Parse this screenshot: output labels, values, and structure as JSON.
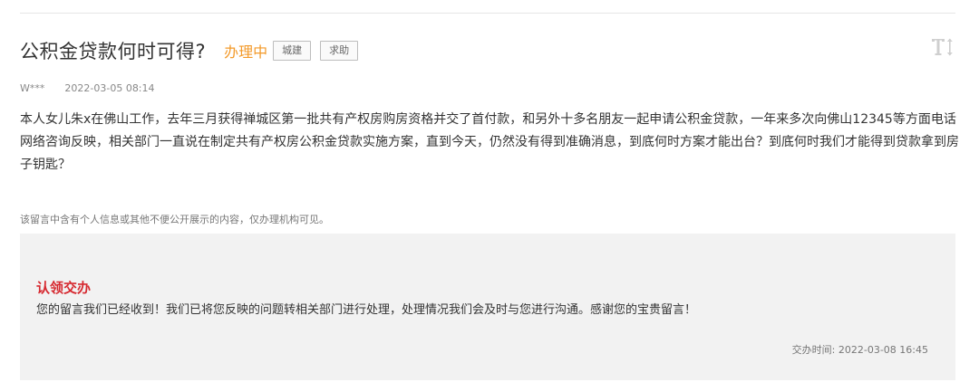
{
  "post": {
    "title": "公积金贷款何时可得?",
    "status": "办理中",
    "tags": [
      "城建",
      "求助"
    ],
    "author": "W***",
    "date": "2022-03-05 08:14",
    "content": "本人女儿朱x在佛山工作，去年三月获得禅城区第一批共有产权房购房资格并交了首付款，和另外十多名朋友一起申请公积金贷款，一年来多次向佛山12345等方面电话网络咨询反映，相关部门一直说在制定共有产权房公积金贷款实施方案，直到今天，仍然没有得到准确消息，到底何时方案才能出台？到底何时我们才能得到贷款拿到房子钥匙？",
    "privacy_notice": "该留言中含有个人信息或其他不便公开展示的内容，仅办理机构可见。"
  },
  "reply": {
    "title": "认领交办",
    "content": "您的留言我们已经收到！我们已将您反映的问题转相关部门进行处理，处理情况我们会及时与您进行沟通。感谢您的宝贵留言！",
    "time": "交办时间: 2022-03-08 16:45"
  },
  "icons": {
    "font_size": "font-size-icon"
  },
  "colors": {
    "status": "#f39a2a",
    "reply_title": "#d6282f",
    "reply_bg": "#f2f2f2"
  }
}
